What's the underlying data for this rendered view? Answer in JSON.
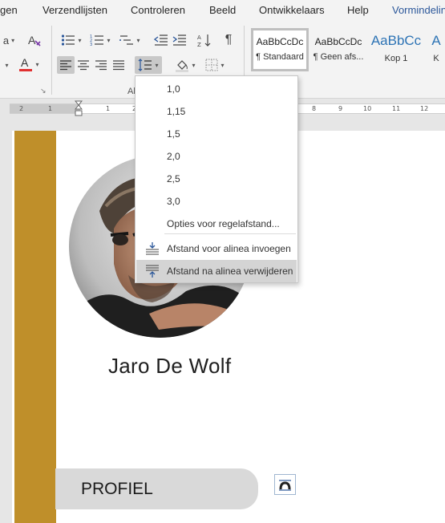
{
  "menu": {
    "items": [
      "gen",
      "Verzendlijsten",
      "Controleren",
      "Beeld",
      "Ontwikkelaars",
      "Help",
      "Vormindelin"
    ]
  },
  "ribbon": {
    "paragraph_group_label": "Al",
    "styles": [
      {
        "sample": "AaBbCcDc",
        "name": "¶ Standaard"
      },
      {
        "sample": "AaBbCcDc",
        "name": "¶ Geen afs..."
      },
      {
        "sample": "AaBbCc",
        "name": "Kop 1"
      },
      {
        "sample": "A",
        "name": "K"
      }
    ]
  },
  "ruler": {
    "ticks": [
      "2",
      "1",
      "1",
      "2",
      "8",
      "9",
      "10",
      "11",
      "12"
    ]
  },
  "line_spacing_menu": {
    "options": [
      "1,0",
      "1,15",
      "1,5",
      "2,0",
      "2,5",
      "3,0"
    ],
    "more_options": "Opties voor regelafstand...",
    "add_space_before": "Afstand voor alinea invoegen",
    "remove_space_after": "Afstand na alinea verwijderen"
  },
  "document": {
    "name": "Jaro De Wolf",
    "section_heading": "PROFIEL",
    "accent_color": "#bf8f2a"
  },
  "colors": {
    "ribbon_bg": "#f3f3f3",
    "highlight": "#d4d4d4",
    "tab_active": "#2b579a"
  }
}
